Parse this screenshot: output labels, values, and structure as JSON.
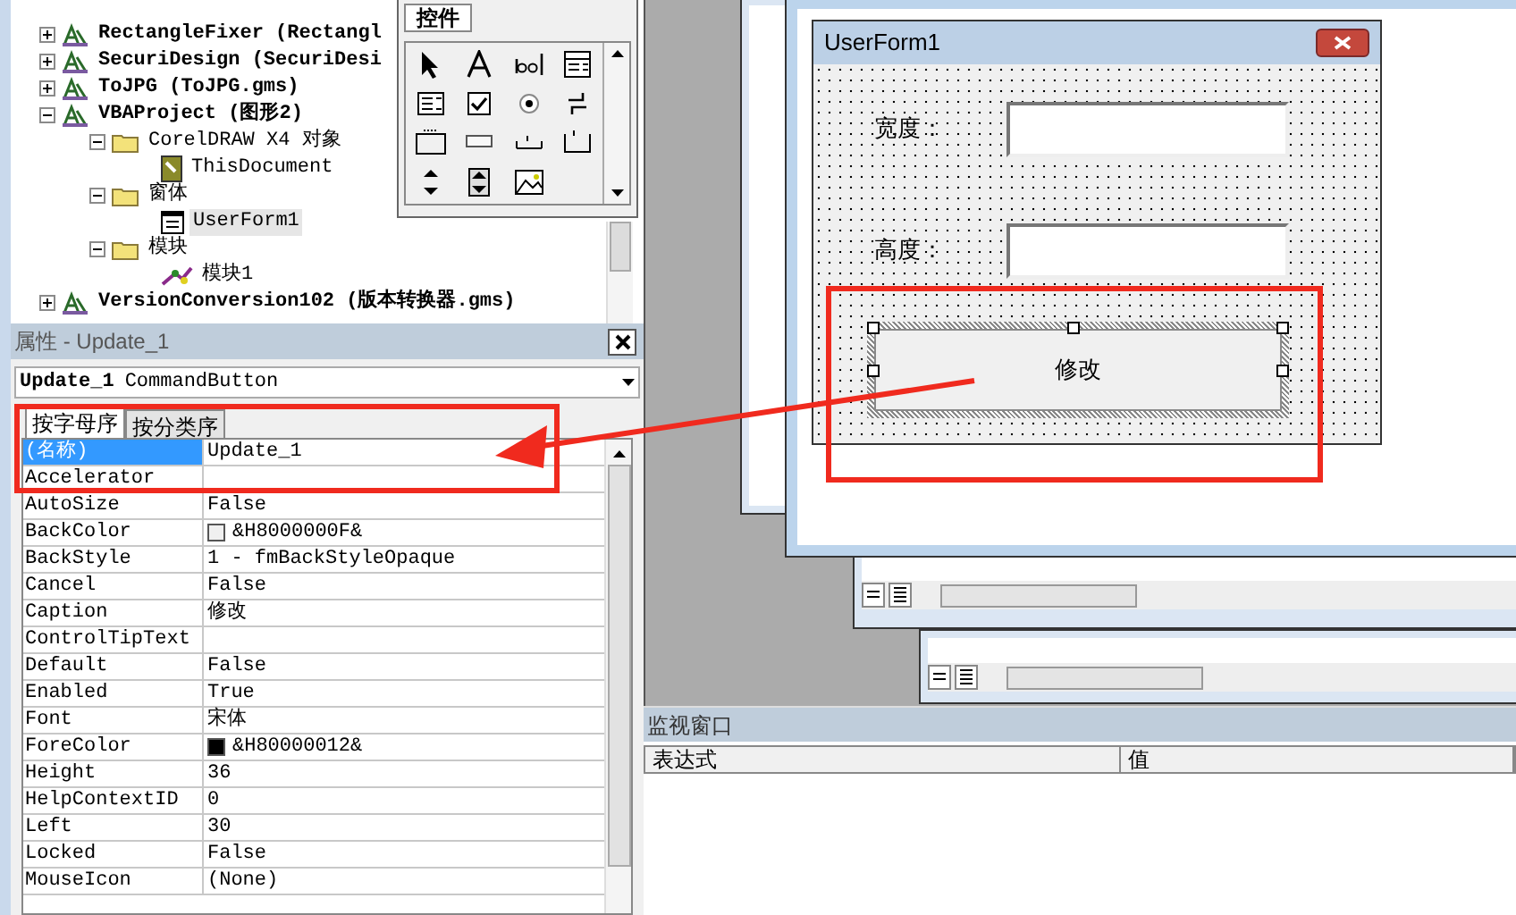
{
  "project_tree": [
    {
      "label": "RectangleFixer (Rectangl",
      "kind": "project",
      "expanded": false
    },
    {
      "label": "SecuriDesign (SecuriDesi",
      "kind": "project",
      "expanded": false
    },
    {
      "label": "ToJPG (ToJPG.gms)",
      "kind": "project",
      "expanded": false
    },
    {
      "label": "VBAProject (图形2)",
      "kind": "project",
      "expanded": true,
      "children": [
        {
          "label": "CorelDRAW X4 对象",
          "kind": "folder",
          "expanded": true,
          "children": [
            {
              "label": "ThisDocument",
              "kind": "document",
              "selected": false
            }
          ]
        },
        {
          "label": "窗体",
          "kind": "folder",
          "expanded": true,
          "children": [
            {
              "label": "UserForm1",
              "kind": "form",
              "selected": true
            }
          ]
        },
        {
          "label": "模块",
          "kind": "folder",
          "expanded": true,
          "children": [
            {
              "label": "模块1",
              "kind": "module",
              "selected": false
            }
          ]
        }
      ]
    },
    {
      "label": "VersionConversion102 (版本转换器.gms)",
      "kind": "project",
      "expanded": false
    }
  ],
  "toolbox": {
    "tab": "控件"
  },
  "properties": {
    "title": "属性 - Update_1",
    "object_name": "Update_1",
    "object_type": "CommandButton",
    "tabs": [
      {
        "label": "按字母序",
        "selected": true
      },
      {
        "label": "按分类序",
        "selected": false
      }
    ],
    "rows": [
      {
        "name": "(名称)",
        "value": "Update_1",
        "selected": true
      },
      {
        "name": "Accelerator",
        "selected": false
      },
      {
        "name": "AutoSize",
        "value": "False",
        "selected": false
      },
      {
        "name": "BackColor",
        "value": "&H8000000F&",
        "color": "#f0f0f0",
        "selected": false
      },
      {
        "name": "BackStyle",
        "value": "1 - fmBackStyleOpaque",
        "selected": false
      },
      {
        "name": "Cancel",
        "value": "False",
        "selected": false
      },
      {
        "name": "Caption",
        "value": "修改",
        "selected": false
      },
      {
        "name": "ControlTipText",
        "selected": false
      },
      {
        "name": "Default",
        "value": "False",
        "selected": false
      },
      {
        "name": "Enabled",
        "value": "True",
        "selected": false
      },
      {
        "name": "Font",
        "value": "宋体",
        "selected": false
      },
      {
        "name": "ForeColor",
        "value": "&H80000012&",
        "color": "#000000",
        "selected": false
      },
      {
        "name": "Height",
        "value": "36",
        "selected": false
      },
      {
        "name": "HelpContextID",
        "value": "0",
        "selected": false
      },
      {
        "name": "Left",
        "value": "30",
        "selected": false
      },
      {
        "name": "Locked",
        "value": "False",
        "selected": false
      },
      {
        "name": "MouseIcon",
        "value": "(None)",
        "selected": false
      }
    ]
  },
  "userform": {
    "title": "UserForm1",
    "fields": [
      {
        "label": "宽度："
      },
      {
        "label": "高度："
      }
    ],
    "button": {
      "label": "修改",
      "selected": true
    }
  },
  "watch": {
    "title": "监视窗口",
    "columns": [
      "表达式",
      "值"
    ]
  }
}
